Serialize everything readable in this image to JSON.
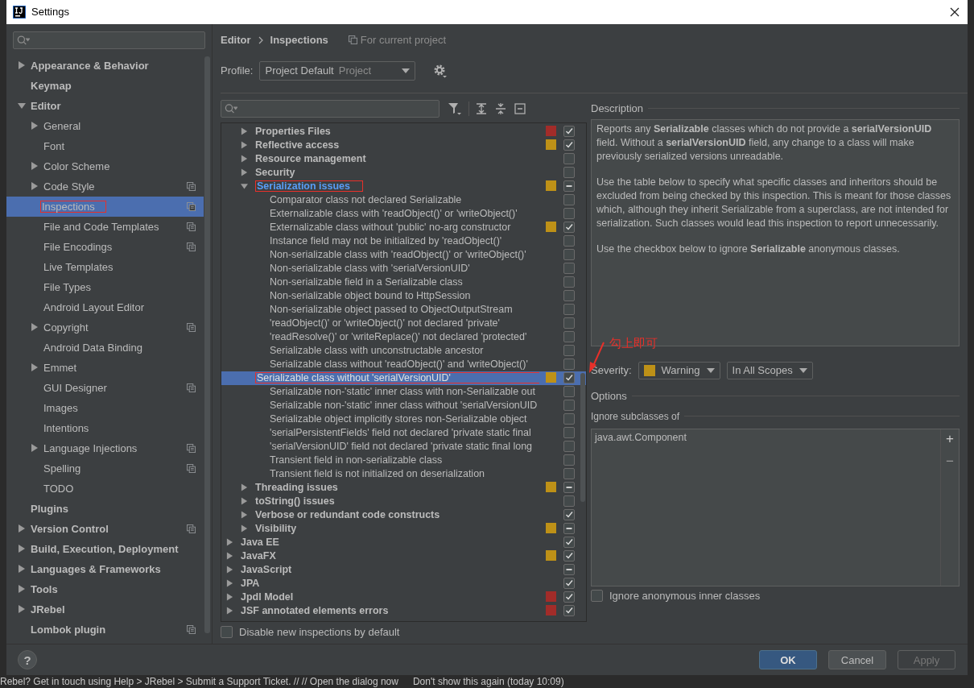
{
  "window": {
    "title": "Settings"
  },
  "sidebar": {
    "items": [
      {
        "label": "Appearance & Behavior",
        "expanded": false,
        "project": false,
        "selected": false,
        "outlined": false
      },
      {
        "label": "Keymap",
        "project": false,
        "selected": false,
        "outlined": false
      },
      {
        "label": "Editor",
        "expanded": true,
        "project": false,
        "selected": false,
        "outlined": false,
        "children": [
          {
            "label": "General",
            "expanded": false,
            "project": false,
            "selected": false,
            "outlined": false
          },
          {
            "label": "Font",
            "project": false,
            "selected": false,
            "outlined": false
          },
          {
            "label": "Color Scheme",
            "expanded": false,
            "project": false,
            "selected": false,
            "outlined": false
          },
          {
            "label": "Code Style",
            "expanded": false,
            "project": true,
            "selected": false,
            "outlined": false
          },
          {
            "label": "Inspections",
            "project": true,
            "selected": true,
            "outlined": true
          },
          {
            "label": "File and Code Templates",
            "project": true,
            "selected": false,
            "outlined": false
          },
          {
            "label": "File Encodings",
            "project": true,
            "selected": false,
            "outlined": false
          },
          {
            "label": "Live Templates",
            "project": false,
            "selected": false,
            "outlined": false
          },
          {
            "label": "File Types",
            "project": false,
            "selected": false,
            "outlined": false
          },
          {
            "label": "Android Layout Editor",
            "project": false,
            "selected": false,
            "outlined": false
          },
          {
            "label": "Copyright",
            "expanded": false,
            "project": true,
            "selected": false,
            "outlined": false
          },
          {
            "label": "Android Data Binding",
            "project": false,
            "selected": false,
            "outlined": false
          },
          {
            "label": "Emmet",
            "expanded": false,
            "project": false,
            "selected": false,
            "outlined": false
          },
          {
            "label": "GUI Designer",
            "project": true,
            "selected": false,
            "outlined": false
          },
          {
            "label": "Images",
            "project": false,
            "selected": false,
            "outlined": false
          },
          {
            "label": "Intentions",
            "project": false,
            "selected": false,
            "outlined": false
          },
          {
            "label": "Language Injections",
            "expanded": false,
            "project": true,
            "selected": false,
            "outlined": false
          },
          {
            "label": "Spelling",
            "project": true,
            "selected": false,
            "outlined": false
          },
          {
            "label": "TODO",
            "project": false,
            "selected": false,
            "outlined": false
          }
        ]
      },
      {
        "label": "Plugins",
        "project": false,
        "selected": false,
        "outlined": false
      },
      {
        "label": "Version Control",
        "expanded": false,
        "project": true,
        "selected": false,
        "outlined": false
      },
      {
        "label": "Build, Execution, Deployment",
        "expanded": false,
        "project": false,
        "selected": false,
        "outlined": false
      },
      {
        "label": "Languages & Frameworks",
        "expanded": false,
        "project": false,
        "selected": false,
        "outlined": false
      },
      {
        "label": "Tools",
        "expanded": false,
        "project": false,
        "selected": false,
        "outlined": false
      },
      {
        "label": "JRebel",
        "expanded": false,
        "project": false,
        "selected": false,
        "outlined": false
      },
      {
        "label": "Lombok plugin",
        "project": true,
        "selected": false,
        "outlined": false
      }
    ]
  },
  "breadcrumb": [
    "Editor",
    "Inspections"
  ],
  "scope_note": "For current project",
  "profile": {
    "label": "Profile:",
    "value": "Project Default",
    "tag": "Project"
  },
  "tree": {
    "java_groups": [
      {
        "label": "Properties Files",
        "expanded": false,
        "color": "#a22c29",
        "checked": true,
        "mixed": false,
        "outlined": false
      },
      {
        "label": "Reflective access",
        "expanded": false,
        "color": "#be9117",
        "checked": true,
        "mixed": false,
        "outlined": false
      },
      {
        "label": "Resource management",
        "expanded": false,
        "checked": false,
        "mixed": false,
        "outlined": false
      },
      {
        "label": "Security",
        "expanded": false,
        "checked": false,
        "mixed": false,
        "outlined": false
      },
      {
        "label": "Serialization issues",
        "expanded": true,
        "color": "#be9117",
        "checked": true,
        "mixed": true,
        "outlined": true,
        "children": [
          {
            "label": "Comparator class not declared Serializable",
            "checked": false,
            "selected": false,
            "outlined": false
          },
          {
            "label": "Externalizable class with 'readObject()' or 'writeObject()'",
            "checked": false,
            "selected": false,
            "outlined": false
          },
          {
            "label": "Externalizable class without 'public' no-arg constructor",
            "color": "#be9117",
            "checked": true,
            "selected": false,
            "outlined": false
          },
          {
            "label": "Instance field may not be initialized by 'readObject()'",
            "checked": false,
            "selected": false,
            "outlined": false
          },
          {
            "label": "Non-serializable class with 'readObject()' or 'writeObject()'",
            "checked": false,
            "selected": false,
            "outlined": false
          },
          {
            "label": "Non-serializable class with 'serialVersionUID'",
            "checked": false,
            "selected": false,
            "outlined": false
          },
          {
            "label": "Non-serializable field in a Serializable class",
            "checked": false,
            "selected": false,
            "outlined": false
          },
          {
            "label": "Non-serializable object bound to HttpSession",
            "checked": false,
            "selected": false,
            "outlined": false
          },
          {
            "label": "Non-serializable object passed to ObjectOutputStream",
            "checked": false,
            "selected": false,
            "outlined": false
          },
          {
            "label": "'readObject()' or 'writeObject()' not declared 'private'",
            "checked": false,
            "selected": false,
            "outlined": false
          },
          {
            "label": "'readResolve()' or 'writeReplace()' not declared 'protected'",
            "checked": false,
            "selected": false,
            "outlined": false
          },
          {
            "label": "Serializable class with unconstructable ancestor",
            "checked": false,
            "selected": false,
            "outlined": false
          },
          {
            "label": "Serializable class without 'readObject()' and 'writeObject()'",
            "checked": false,
            "selected": false,
            "outlined": false
          },
          {
            "label": "Serializable class without 'serialVersionUID'",
            "color": "#be9117",
            "checked": true,
            "selected": true,
            "outlined": true
          },
          {
            "label": "Serializable non-'static' inner class with non-Serializable out",
            "checked": false,
            "selected": false,
            "outlined": false
          },
          {
            "label": "Serializable non-'static' inner class without 'serialVersionUID",
            "checked": false,
            "selected": false,
            "outlined": false
          },
          {
            "label": "Serializable object implicitly stores non-Serializable object",
            "checked": false,
            "selected": false,
            "outlined": false
          },
          {
            "label": "'serialPersistentFields' field not declared 'private static final",
            "checked": false,
            "selected": false,
            "outlined": false
          },
          {
            "label": "'serialVersionUID' field not declared 'private static final long",
            "checked": false,
            "selected": false,
            "outlined": false
          },
          {
            "label": "Transient field in non-serializable class",
            "checked": false,
            "selected": false,
            "outlined": false
          },
          {
            "label": "Transient field is not initialized on deserialization",
            "checked": false,
            "selected": false,
            "outlined": false
          }
        ]
      },
      {
        "label": "Threading issues",
        "expanded": false,
        "color": "#be9117",
        "checked": true,
        "mixed": true,
        "outlined": false
      },
      {
        "label": "toString() issues",
        "expanded": false,
        "checked": false,
        "mixed": false,
        "outlined": false
      },
      {
        "label": "Verbose or redundant code constructs",
        "expanded": false,
        "checked": true,
        "mixed": false,
        "outlined": false
      },
      {
        "label": "Visibility",
        "expanded": false,
        "color": "#be9117",
        "checked": true,
        "mixed": true,
        "outlined": false
      }
    ],
    "groups": [
      {
        "label": "Java EE",
        "expanded": false,
        "checked": true,
        "mixed": false,
        "outlined": false
      },
      {
        "label": "JavaFX",
        "expanded": false,
        "color": "#be9117",
        "checked": true,
        "mixed": false,
        "outlined": false
      },
      {
        "label": "JavaScript",
        "expanded": false,
        "checked": true,
        "mixed": true,
        "outlined": false
      },
      {
        "label": "JPA",
        "expanded": false,
        "checked": true,
        "mixed": false,
        "outlined": false
      },
      {
        "label": "Jpdl Model",
        "expanded": false,
        "color": "#a22c29",
        "checked": true,
        "mixed": false,
        "outlined": false
      },
      {
        "label": "JSF annotated elements errors",
        "expanded": false,
        "color": "#a22c29",
        "checked": true,
        "mixed": false,
        "outlined": false
      }
    ]
  },
  "disable_new": {
    "label": "Disable new inspections by default",
    "checked": false
  },
  "description": {
    "title": "Description",
    "paragraphs": [
      "Reports any **Serializable** classes which do not provide a **serialVersionUID** field. Without a **serialVersionUID** field, any change to a class will make previously serialized versions unreadable.",
      "Use the table below to specify what specific classes and inheritors should be excluded from being checked by this inspection. This is meant for those classes which, although they inherit Serializable from a superclass, are not intended for serialization. Such classes would lead this inspection to report unnecessarily.",
      "Use the checkbox below to ignore **Serializable** anonymous classes."
    ]
  },
  "annotation": {
    "text": "勾上即可"
  },
  "severity": {
    "label": "Severity:",
    "value": "Warning",
    "color": "#be9117",
    "scope": "In All Scopes"
  },
  "options": {
    "title": "Options",
    "subtitle": "Ignore subclasses of",
    "classes": [
      "java.awt.Component"
    ],
    "add": "+",
    "remove": "−",
    "ignore_anonymous": {
      "label": "Ignore anonymous inner classes",
      "checked": false
    }
  },
  "buttons": [
    {
      "label": "OK",
      "kind": "primary",
      "disabled": false
    },
    {
      "label": "Cancel",
      "kind": "normal",
      "disabled": false
    },
    {
      "label": "Apply",
      "kind": "normal",
      "disabled": true
    }
  ],
  "help": "?",
  "background_status": [
    "Rebel? Get in touch using Help > JRebel > Submit a Support Ticket. // // Open the dialog now",
    "Don't show this again (today 10:09)"
  ]
}
